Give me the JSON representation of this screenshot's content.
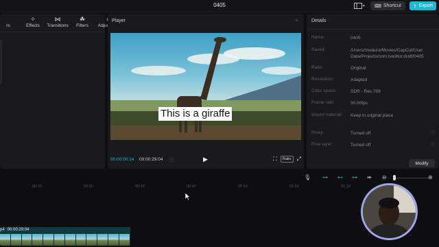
{
  "app": {
    "title": "0405"
  },
  "topbar": {
    "layout_icon": "layout-icon",
    "shortcut_label": "Shortcut",
    "export_label": "Export"
  },
  "media_panel": {
    "tools": [
      {
        "label": "rs",
        "icon": "text-icon"
      },
      {
        "label": "Effects",
        "icon": "effects-icon"
      },
      {
        "label": "Transitions",
        "icon": "transitions-icon"
      },
      {
        "label": "Filters",
        "icon": "filters-icon"
      },
      {
        "label": "Adjustment",
        "icon": "adjustment-icon"
      }
    ]
  },
  "player": {
    "title": "Player",
    "caption": "This is a giraffe",
    "current_time": "00:00:00:14",
    "total_time": "00:00:29:04",
    "ratio_label": "Ratio"
  },
  "details": {
    "title": "Details",
    "fields": [
      {
        "key": "Name:",
        "value": "0405"
      },
      {
        "key": "Saved:",
        "value": "/Users/mwaura/Movies/CapCut/User Data/Projects/com.lveditor.draft/0405"
      },
      {
        "key": "Ratio:",
        "value": "Original"
      },
      {
        "key": "Resolution:",
        "value": "Adapted"
      },
      {
        "key": "Color space:",
        "value": "SDR - Rec.709"
      },
      {
        "key": "Frame rate:",
        "value": "30.00fps"
      },
      {
        "key": "Import material:",
        "value": "Keep in original place"
      },
      {
        "key": "Proxy:",
        "value": "Turned off"
      },
      {
        "key": "Free layer:",
        "value": "Turned off"
      }
    ],
    "modify_label": "Modify"
  },
  "timeline": {
    "ruler": [
      "00:10",
      "00:20",
      "00:30",
      "00:40",
      "00:50",
      "01:00",
      "01:10"
    ],
    "clip": {
      "name": "p4",
      "duration": "00:00:29:04"
    }
  },
  "colors": {
    "accent": "#20b7d2",
    "clip": "#0f3b3f",
    "webcam_ring": "#9aa6e8"
  }
}
